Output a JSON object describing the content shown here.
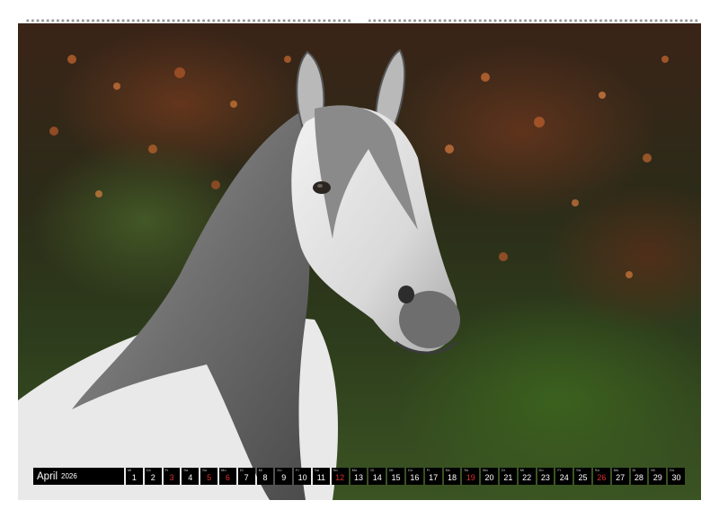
{
  "calendar": {
    "month_label": "April",
    "year_label": "2026",
    "highlight_color": "#d8322e",
    "days": [
      {
        "n": "1",
        "wd": "Mi",
        "red": false
      },
      {
        "n": "2",
        "wd": "Do",
        "red": false
      },
      {
        "n": "3",
        "wd": "Fr",
        "red": true
      },
      {
        "n": "4",
        "wd": "Sa",
        "red": false
      },
      {
        "n": "5",
        "wd": "So",
        "red": true
      },
      {
        "n": "6",
        "wd": "Mo",
        "red": true
      },
      {
        "n": "7",
        "wd": "Di",
        "red": false
      },
      {
        "n": "8",
        "wd": "Mi",
        "red": false
      },
      {
        "n": "9",
        "wd": "Do",
        "red": false
      },
      {
        "n": "10",
        "wd": "Fr",
        "red": false
      },
      {
        "n": "11",
        "wd": "Sa",
        "red": false
      },
      {
        "n": "12",
        "wd": "So",
        "red": true
      },
      {
        "n": "13",
        "wd": "Mo",
        "red": false
      },
      {
        "n": "14",
        "wd": "Di",
        "red": false
      },
      {
        "n": "15",
        "wd": "Mi",
        "red": false
      },
      {
        "n": "16",
        "wd": "Do",
        "red": false
      },
      {
        "n": "17",
        "wd": "Fr",
        "red": false
      },
      {
        "n": "18",
        "wd": "Sa",
        "red": false
      },
      {
        "n": "19",
        "wd": "So",
        "red": true
      },
      {
        "n": "20",
        "wd": "Mo",
        "red": false
      },
      {
        "n": "21",
        "wd": "Di",
        "red": false
      },
      {
        "n": "22",
        "wd": "Mi",
        "red": false
      },
      {
        "n": "23",
        "wd": "Do",
        "red": false
      },
      {
        "n": "24",
        "wd": "Fr",
        "red": false
      },
      {
        "n": "25",
        "wd": "Sa",
        "red": false
      },
      {
        "n": "26",
        "wd": "So",
        "red": true
      },
      {
        "n": "27",
        "wd": "Mo",
        "red": false
      },
      {
        "n": "28",
        "wd": "Di",
        "red": false
      },
      {
        "n": "29",
        "wd": "Mi",
        "red": false
      },
      {
        "n": "30",
        "wd": "Do",
        "red": false
      }
    ]
  }
}
